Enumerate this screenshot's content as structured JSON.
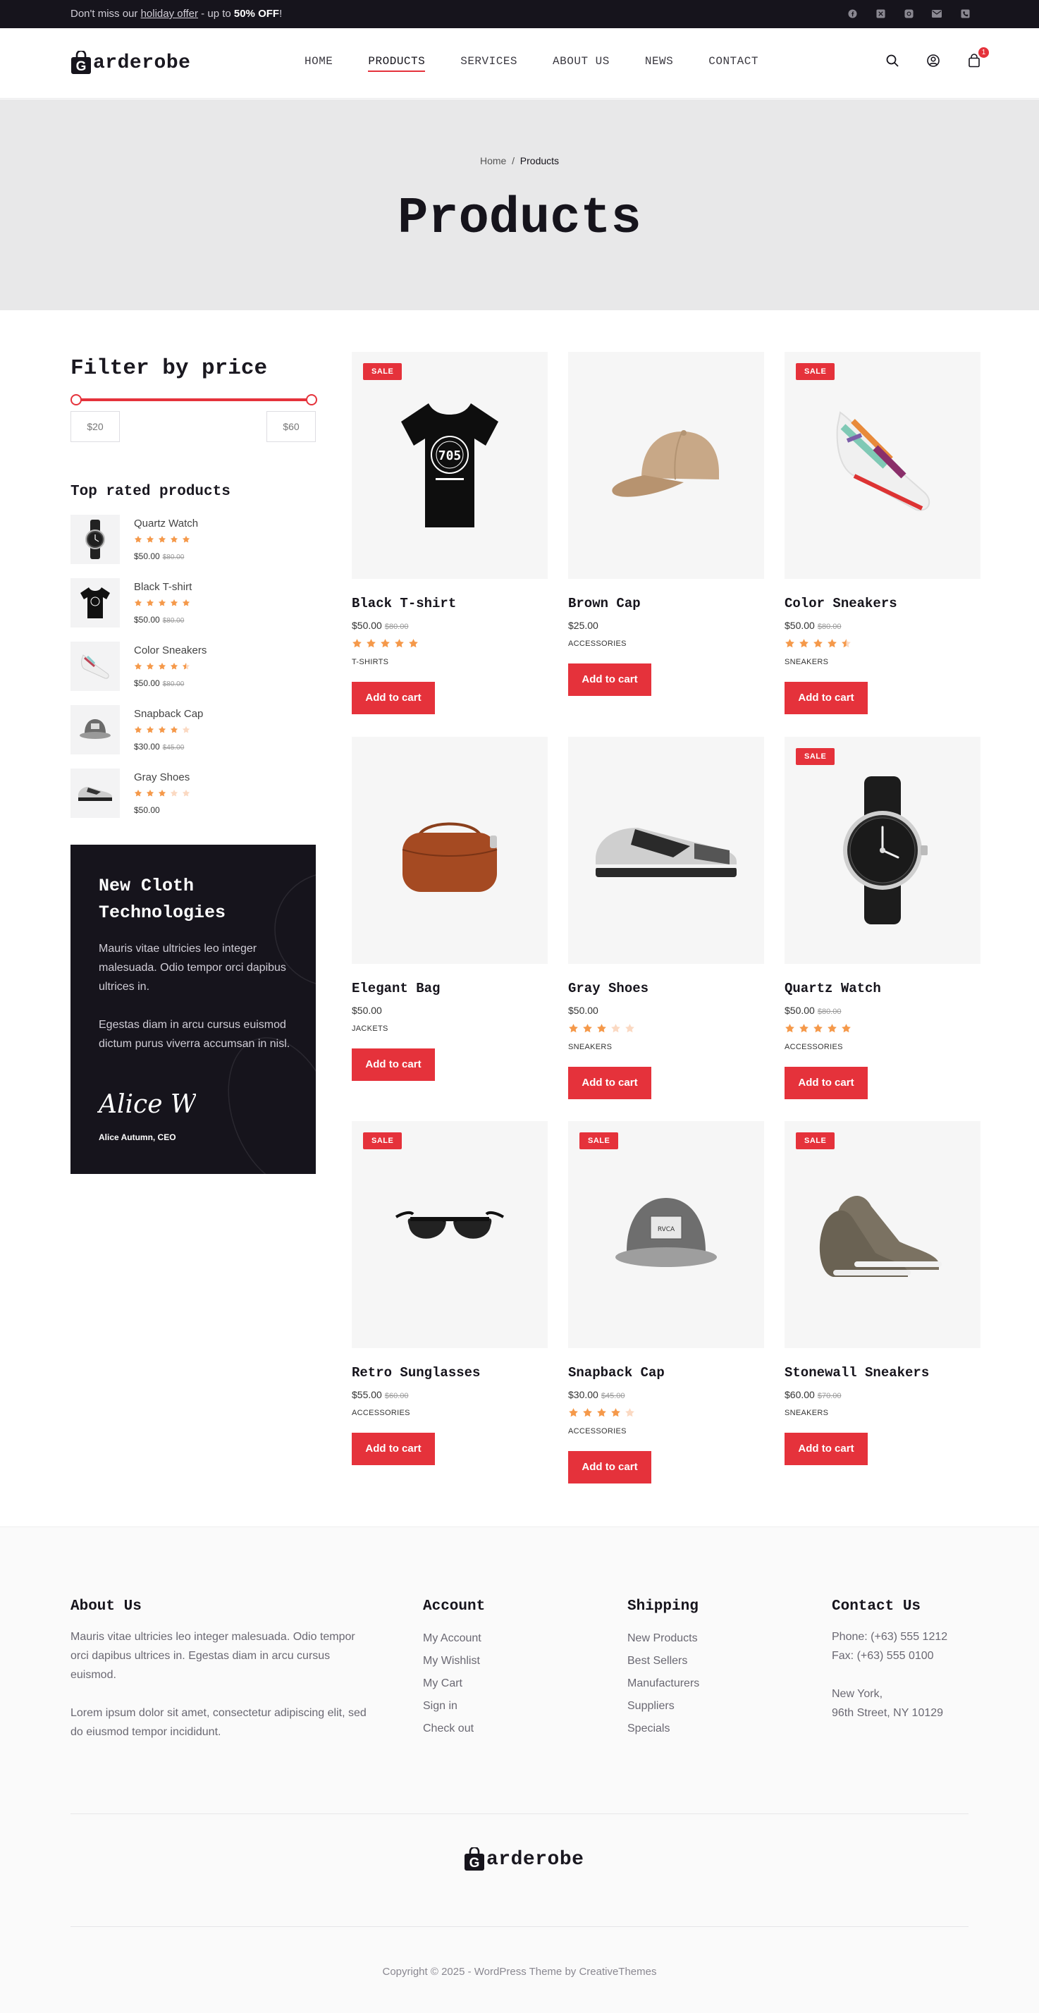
{
  "topbar": {
    "msg_pre": "Don't miss our ",
    "msg_link": "holiday offer",
    "msg_mid": " - up to ",
    "msg_bold": "50% OFF",
    "msg_end": "!",
    "socials": [
      "facebook-icon",
      "x-icon",
      "instagram-icon",
      "mail-icon",
      "phone-icon"
    ]
  },
  "header": {
    "logo_letter": "G",
    "logo_text": "arderobe",
    "nav": [
      "HOME",
      "PRODUCTS",
      "SERVICES",
      "ABOUT US",
      "NEWS",
      "CONTACT"
    ],
    "active_nav": "PRODUCTS",
    "cart_count": "1"
  },
  "hero": {
    "crumb_home": "Home",
    "crumb_sep": "/",
    "crumb_current": "Products",
    "title": "Products"
  },
  "filter": {
    "title": "Filter by price",
    "min": "$20",
    "max": "$60"
  },
  "top_rated": {
    "title": "Top rated products",
    "items": [
      {
        "name": "Quartz Watch",
        "rating": 5,
        "price": "$50.00",
        "old": "$80.00"
      },
      {
        "name": "Black T-shirt",
        "rating": 5,
        "price": "$50.00",
        "old": "$80.00"
      },
      {
        "name": "Color Sneakers",
        "rating": 4.5,
        "price": "$50.00",
        "old": "$80.00"
      },
      {
        "name": "Snapback Cap",
        "rating": 4,
        "price": "$30.00",
        "old": "$45.00"
      },
      {
        "name": "Gray Shoes",
        "rating": 3,
        "price": "$50.00",
        "old": ""
      }
    ]
  },
  "promo": {
    "title": "New Cloth Technologies",
    "p1": "Mauris vitae ultricies leo integer malesuada. Odio tempor orci dapibus ultrices in.",
    "p2": "Egestas diam in arcu cursus euismod dictum purus viverra accumsan in nisl.",
    "signature": "Alice W",
    "author": "Alice Autumn, CEO"
  },
  "products": [
    {
      "name": "Black T-shirt",
      "price": "$50.00",
      "old": "$80.00",
      "sale": "SALE",
      "rating": 5,
      "cat": "T-SHIRTS",
      "btn": "Add to cart"
    },
    {
      "name": "Brown Cap",
      "price": "$25.00",
      "old": "",
      "sale": "",
      "rating": 0,
      "cat": "ACCESSORIES",
      "btn": "Add to cart"
    },
    {
      "name": "Color Sneakers",
      "price": "$50.00",
      "old": "$80.00",
      "sale": "SALE",
      "rating": 4.5,
      "cat": "SNEAKERS",
      "btn": "Add to cart"
    },
    {
      "name": "Elegant Bag",
      "price": "$50.00",
      "old": "",
      "sale": "",
      "rating": 0,
      "cat": "JACKETS",
      "btn": "Add to cart"
    },
    {
      "name": "Gray Shoes",
      "price": "$50.00",
      "old": "",
      "sale": "",
      "rating": 3,
      "cat": "SNEAKERS",
      "btn": "Add to cart"
    },
    {
      "name": "Quartz Watch",
      "price": "$50.00",
      "old": "$80.00",
      "sale": "SALE",
      "rating": 5,
      "cat": "ACCESSORIES",
      "btn": "Add to cart"
    },
    {
      "name": "Retro Sunglasses",
      "price": "$55.00",
      "old": "$60.00",
      "sale": "SALE",
      "rating": 0,
      "cat": "ACCESSORIES",
      "btn": "Add to cart"
    },
    {
      "name": "Snapback Cap",
      "price": "$30.00",
      "old": "$45.00",
      "sale": "SALE",
      "rating": 4,
      "cat": "ACCESSORIES",
      "btn": "Add to cart"
    },
    {
      "name": "Stonewall Sneakers",
      "price": "$60.00",
      "old": "$70.00",
      "sale": "SALE",
      "rating": 0,
      "cat": "SNEAKERS",
      "btn": "Add to cart"
    }
  ],
  "footer": {
    "about_title": "About Us",
    "about_p1": "Mauris vitae ultricies leo integer malesuada. Odio tempor orci dapibus ultrices in. Egestas diam in arcu cursus euismod.",
    "about_p2": "Lorem ipsum dolor sit amet, consectetur adipiscing elit, sed do eiusmod tempor incididunt.",
    "account_title": "Account",
    "account_links": [
      "My Account",
      "My Wishlist",
      "My Cart",
      "Sign in",
      "Check out"
    ],
    "shipping_title": "Shipping",
    "shipping_links": [
      "New Products",
      "Best Sellers",
      "Manufacturers",
      "Suppliers",
      "Specials"
    ],
    "contact_title": "Contact Us",
    "phone": "Phone: (+63) 555 1212",
    "fax": "Fax: (+63) 555 0100",
    "city": "New York,",
    "street": "96th Street, NY 10129",
    "copyright": "Copyright © 2025 - WordPress Theme by CreativeThemes"
  },
  "colors": {
    "accent": "#e5323b",
    "dark": "#16141c",
    "star": "#f5994a",
    "hero_bg": "#e8e8e9"
  }
}
